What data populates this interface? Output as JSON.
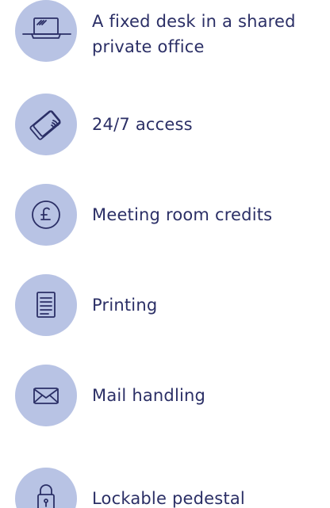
{
  "features": [
    {
      "icon": "laptop-icon",
      "label": "A fixed desk in a shared private office"
    },
    {
      "icon": "access-card-icon",
      "label": "24/7 access"
    },
    {
      "icon": "pound-coin-icon",
      "label": "Meeting room credits"
    },
    {
      "icon": "document-icon",
      "label": "Printing"
    },
    {
      "icon": "envelope-icon",
      "label": "Mail handling"
    },
    {
      "icon": "padlock-icon",
      "label": "Lockable pedestal"
    }
  ],
  "colors": {
    "circle": "#b8c3e4",
    "icon_stroke": "#2b2f66",
    "text": "#2b2f66"
  }
}
